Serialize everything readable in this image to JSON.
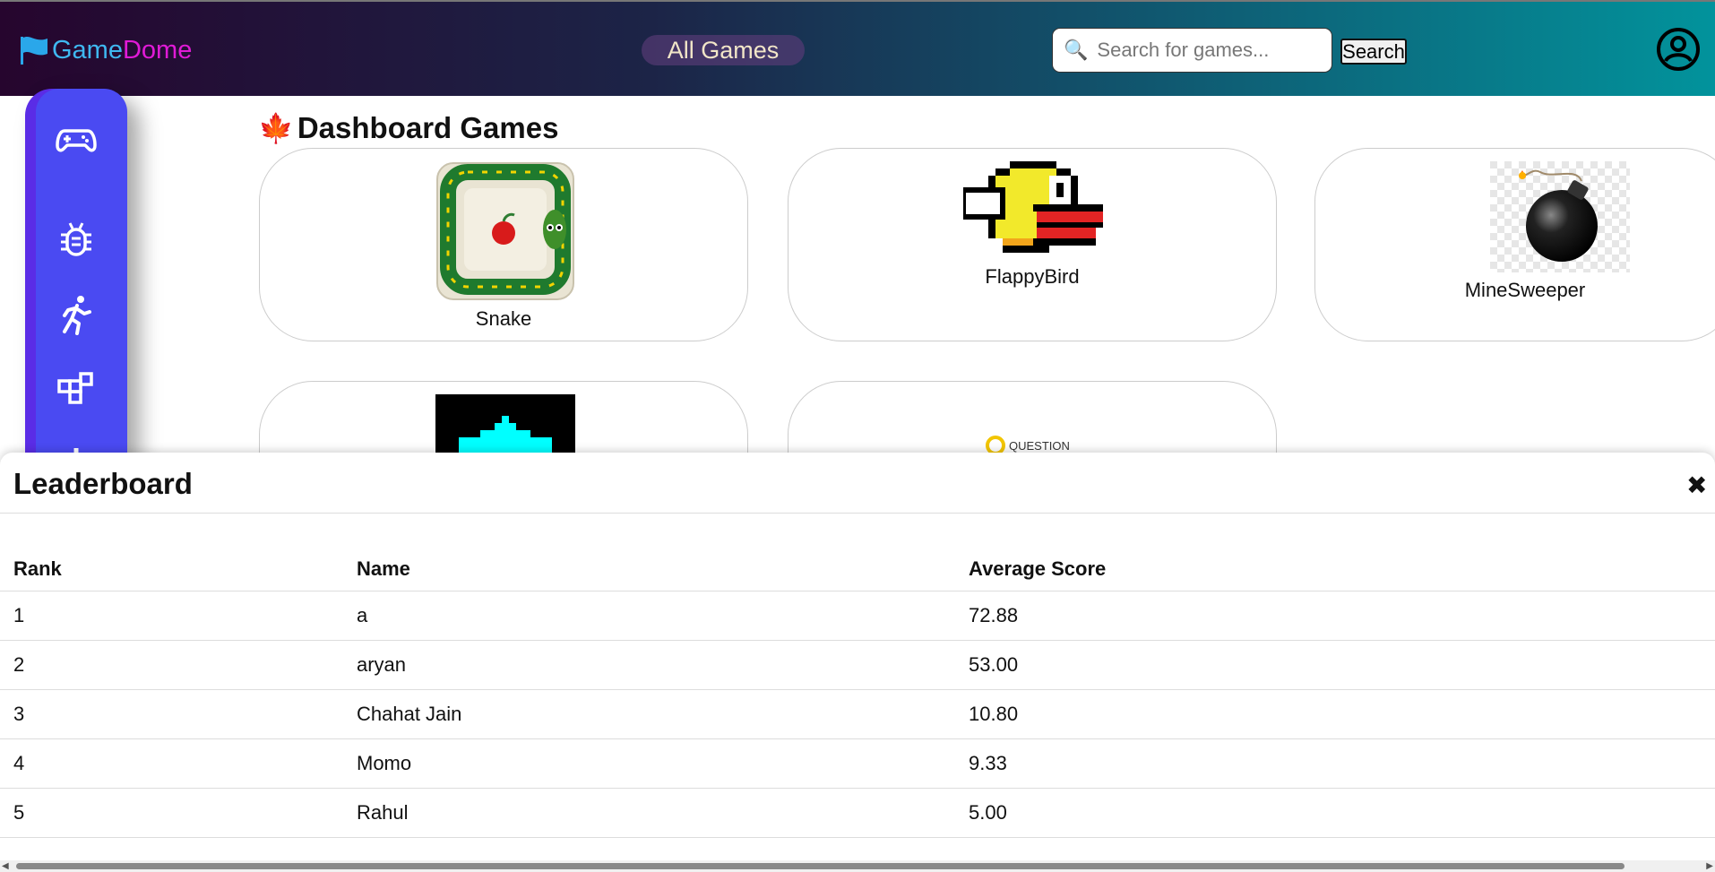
{
  "header": {
    "logo_part1": "Game",
    "logo_part2": "Dome",
    "nav_all_games": "All Games",
    "search_placeholder": "Search for games...",
    "search_button": "Search"
  },
  "sidebar": {
    "items": [
      {
        "icon": "gamepad-icon"
      },
      {
        "icon": "bug-icon"
      },
      {
        "icon": "running-person-icon"
      },
      {
        "icon": "blocks-icon"
      },
      {
        "icon": "gear-icon"
      }
    ]
  },
  "main": {
    "section_title": "Dashboard Games",
    "games": [
      {
        "name": "Snake"
      },
      {
        "name": "FlappyBird"
      },
      {
        "name": "MineSweeper"
      },
      {
        "name": ""
      },
      {
        "name": ""
      }
    ],
    "quiz_thumb_text": "QUESTION"
  },
  "leaderboard": {
    "title": "Leaderboard",
    "close_icon": "✖",
    "columns": [
      "Rank",
      "Name",
      "Average Score"
    ],
    "rows": [
      {
        "rank": "1",
        "name": "a",
        "score": "72.88"
      },
      {
        "rank": "2",
        "name": "aryan",
        "score": "53.00"
      },
      {
        "rank": "3",
        "name": "Chahat Jain",
        "score": "10.80"
      },
      {
        "rank": "4",
        "name": "Momo",
        "score": "9.33"
      },
      {
        "rank": "5",
        "name": "Rahul",
        "score": "5.00"
      }
    ]
  },
  "colors": {
    "sidebar": "#4a4af2",
    "logo_game": "#3fb8f0",
    "logo_dome": "#e01ad6"
  }
}
